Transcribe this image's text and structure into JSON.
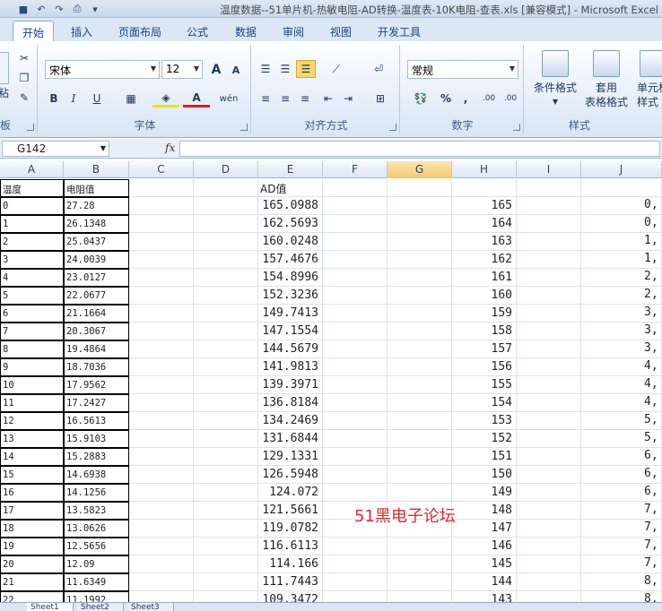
{
  "window": {
    "title": "温度数据--51单片机-热敏电阻-AD转换-温度表-10K电阻-查表.xls  [兼容模式] - Microsoft Excel"
  },
  "tabs": [
    "开始",
    "插入",
    "页面布局",
    "公式",
    "数据",
    "审阅",
    "视图",
    "开发工具"
  ],
  "ribbon": {
    "clipboard_label": "板",
    "paste_label": "粘",
    "font": {
      "name": "宋体",
      "size": "12",
      "label": "字体",
      "bold": "B",
      "italic": "I",
      "underline": "U",
      "grow": "A",
      "shrink": "A",
      "phonetic": "wén"
    },
    "alignment": {
      "label": "对齐方式"
    },
    "number": {
      "format": "常规",
      "label": "数字",
      "percent": "%",
      "comma": ",",
      "inc_decimal": ".00",
      "dec_decimal": ".00"
    },
    "styles": {
      "conditional": "条件格式",
      "table_fmt_1": "套用",
      "table_fmt_2": "表格格式",
      "cell_style_1": "单元格",
      "cell_style_2": "样式",
      "label": "样式"
    }
  },
  "formula_bar": {
    "name_box": "G142",
    "fx": "fx"
  },
  "columns": [
    "A",
    "B",
    "C",
    "D",
    "E",
    "F",
    "G",
    "H",
    "I",
    "J"
  ],
  "selected_column": "G",
  "header_row": {
    "A": "温度",
    "B": "电阻值",
    "E": "AD值"
  },
  "rows": [
    {
      "A": "0",
      "B": "27.28",
      "E": "165.0988",
      "H": "165",
      "J": "0,"
    },
    {
      "A": "1",
      "B": "26.1348",
      "E": "162.5693",
      "H": "164",
      "J": "0,"
    },
    {
      "A": "2",
      "B": "25.0437",
      "E": "160.0248",
      "H": "163",
      "J": "1,"
    },
    {
      "A": "3",
      "B": "24.0039",
      "E": "157.4676",
      "H": "162",
      "J": "1,"
    },
    {
      "A": "4",
      "B": "23.0127",
      "E": "154.8996",
      "H": "161",
      "J": "2,"
    },
    {
      "A": "5",
      "B": "22.0677",
      "E": "152.3236",
      "H": "160",
      "J": "2,"
    },
    {
      "A": "6",
      "B": "21.1664",
      "E": "149.7413",
      "H": "159",
      "J": "3,"
    },
    {
      "A": "7",
      "B": "20.3067",
      "E": "147.1554",
      "H": "158",
      "J": "3,"
    },
    {
      "A": "8",
      "B": "19.4864",
      "E": "144.5679",
      "H": "157",
      "J": "3,"
    },
    {
      "A": "9",
      "B": "18.7036",
      "E": "141.9813",
      "H": "156",
      "J": "4,"
    },
    {
      "A": "10",
      "B": "17.9562",
      "E": "139.3971",
      "H": "155",
      "J": "4,"
    },
    {
      "A": "11",
      "B": "17.2427",
      "E": "136.8184",
      "H": "154",
      "J": "4,"
    },
    {
      "A": "12",
      "B": "16.5613",
      "E": "134.2469",
      "H": "153",
      "J": "5,"
    },
    {
      "A": "13",
      "B": "15.9103",
      "E": "131.6844",
      "H": "152",
      "J": "5,"
    },
    {
      "A": "14",
      "B": "15.2883",
      "E": "129.1331",
      "H": "151",
      "J": "6,"
    },
    {
      "A": "15",
      "B": "14.6938",
      "E": "126.5948",
      "H": "150",
      "J": "6,"
    },
    {
      "A": "16",
      "B": "14.1256",
      "E": "124.072",
      "H": "149",
      "J": "6,"
    },
    {
      "A": "17",
      "B": "13.5823",
      "E": "121.5661",
      "H": "148",
      "J": "7,"
    },
    {
      "A": "18",
      "B": "13.0626",
      "E": "119.0782",
      "H": "147",
      "J": "7,"
    },
    {
      "A": "19",
      "B": "12.5656",
      "E": "116.6113",
      "H": "146",
      "J": "7,"
    },
    {
      "A": "20",
      "B": "12.09",
      "E": "114.166",
      "H": "145",
      "J": "7,"
    },
    {
      "A": "21",
      "B": "11.6349",
      "E": "111.7443",
      "H": "144",
      "J": "8,"
    },
    {
      "A": "22",
      "B": "11.1992",
      "E": "109.3472",
      "H": "143",
      "J": "8,"
    }
  ],
  "watermark": "51黑电子论坛",
  "sheets": [
    "Sheet1",
    "Sheet2",
    "Sheet3"
  ],
  "colors": {
    "accent": "#15428b",
    "watermark": "#e0292a",
    "selected_header": "#f6c96a"
  }
}
